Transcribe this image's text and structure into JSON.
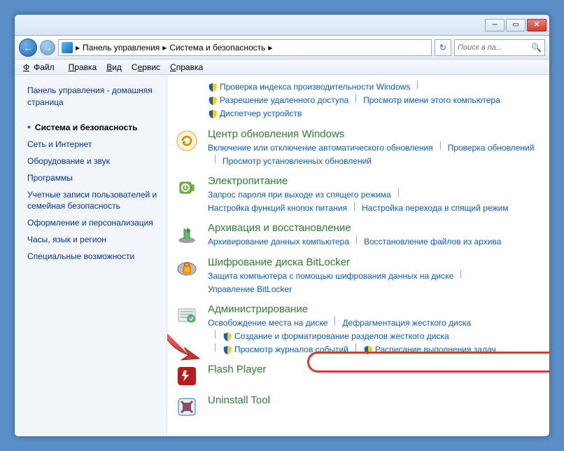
{
  "breadcrumb": {
    "root": "Панель управления",
    "current": "Система и безопасность"
  },
  "search": {
    "placeholder": "Поиск в па..."
  },
  "menu": {
    "file": "Файл",
    "edit": "Правка",
    "view": "Вид",
    "tools": "Сервис",
    "help": "Справка"
  },
  "sidebar": {
    "home": "Панель управления - домашняя страница",
    "items": [
      "Система и безопасность",
      "Сеть и Интернет",
      "Оборудование и звук",
      "Программы",
      "Учетные записи пользователей и семейная безопасность",
      "Оформление и персонализация",
      "Часы, язык и регион",
      "Специальные возможности"
    ]
  },
  "top_links": [
    "Проверка индекса производительности Windows",
    "Разрешение удаленного доступа",
    "Просмотр имени этого компьютера",
    "Диспетчер устройств"
  ],
  "sections": [
    {
      "title": "Центр обновления Windows",
      "icon": "update",
      "links": [
        "Включение или отключение автоматического обновления",
        "Проверка обновлений",
        "Просмотр установленных обновлений"
      ]
    },
    {
      "title": "Электропитание",
      "icon": "power",
      "links": [
        "Запрос пароля при выходе из спящего режима",
        "Настройка функций кнопок питания",
        "Настройка перехода в спящий режим"
      ]
    },
    {
      "title": "Архивация и восстановление",
      "icon": "backup",
      "links": [
        "Архивирование данных компьютера",
        "Восстановление файлов из архива"
      ]
    },
    {
      "title": "Шифрование диска BitLocker",
      "icon": "bitlocker",
      "links": [
        "Защита компьютера с помощью шифрования данных на диске",
        "Управление BitLocker"
      ]
    },
    {
      "title": "Администрирование",
      "icon": "admin",
      "links": [
        "Освобождение места на диске",
        "Дефрагментация жесткого диска",
        "Создание и форматирование разделов жесткого диска",
        "Просмотр журналов событий",
        "Расписание выполнения задач"
      ],
      "shielded": [
        2,
        3,
        4
      ]
    },
    {
      "title": "Flash Player",
      "icon": "flash",
      "links": []
    },
    {
      "title": "Uninstall Tool",
      "icon": "uninstall",
      "links": []
    }
  ]
}
